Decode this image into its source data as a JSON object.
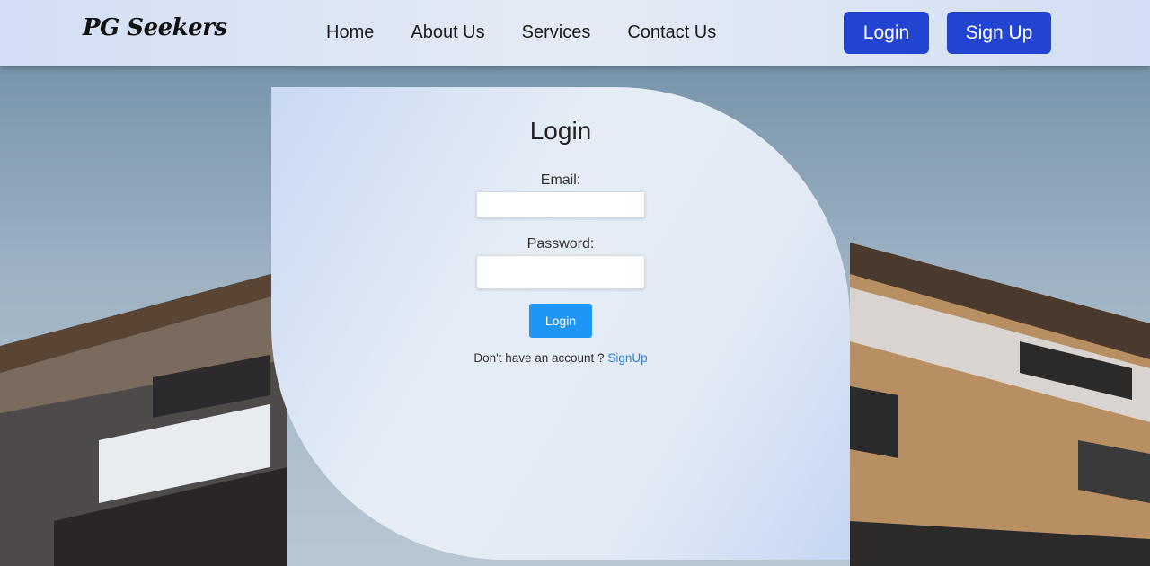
{
  "navbar": {
    "logo": "PG Seekers",
    "links": [
      "Home",
      "About Us",
      "Services",
      "Contact Us"
    ],
    "login_label": "Login",
    "signup_label": "Sign Up"
  },
  "form": {
    "title": "Login",
    "email_label": "Email:",
    "email_value": "",
    "password_label": "Password:",
    "password_value": "",
    "submit_label": "Login",
    "no_account_text": "Don't have an account ? ",
    "signup_link": "SignUp"
  },
  "colors": {
    "nav_button": "#2344d0",
    "submit_button": "#1f95f5",
    "link": "#2b7fd6"
  }
}
